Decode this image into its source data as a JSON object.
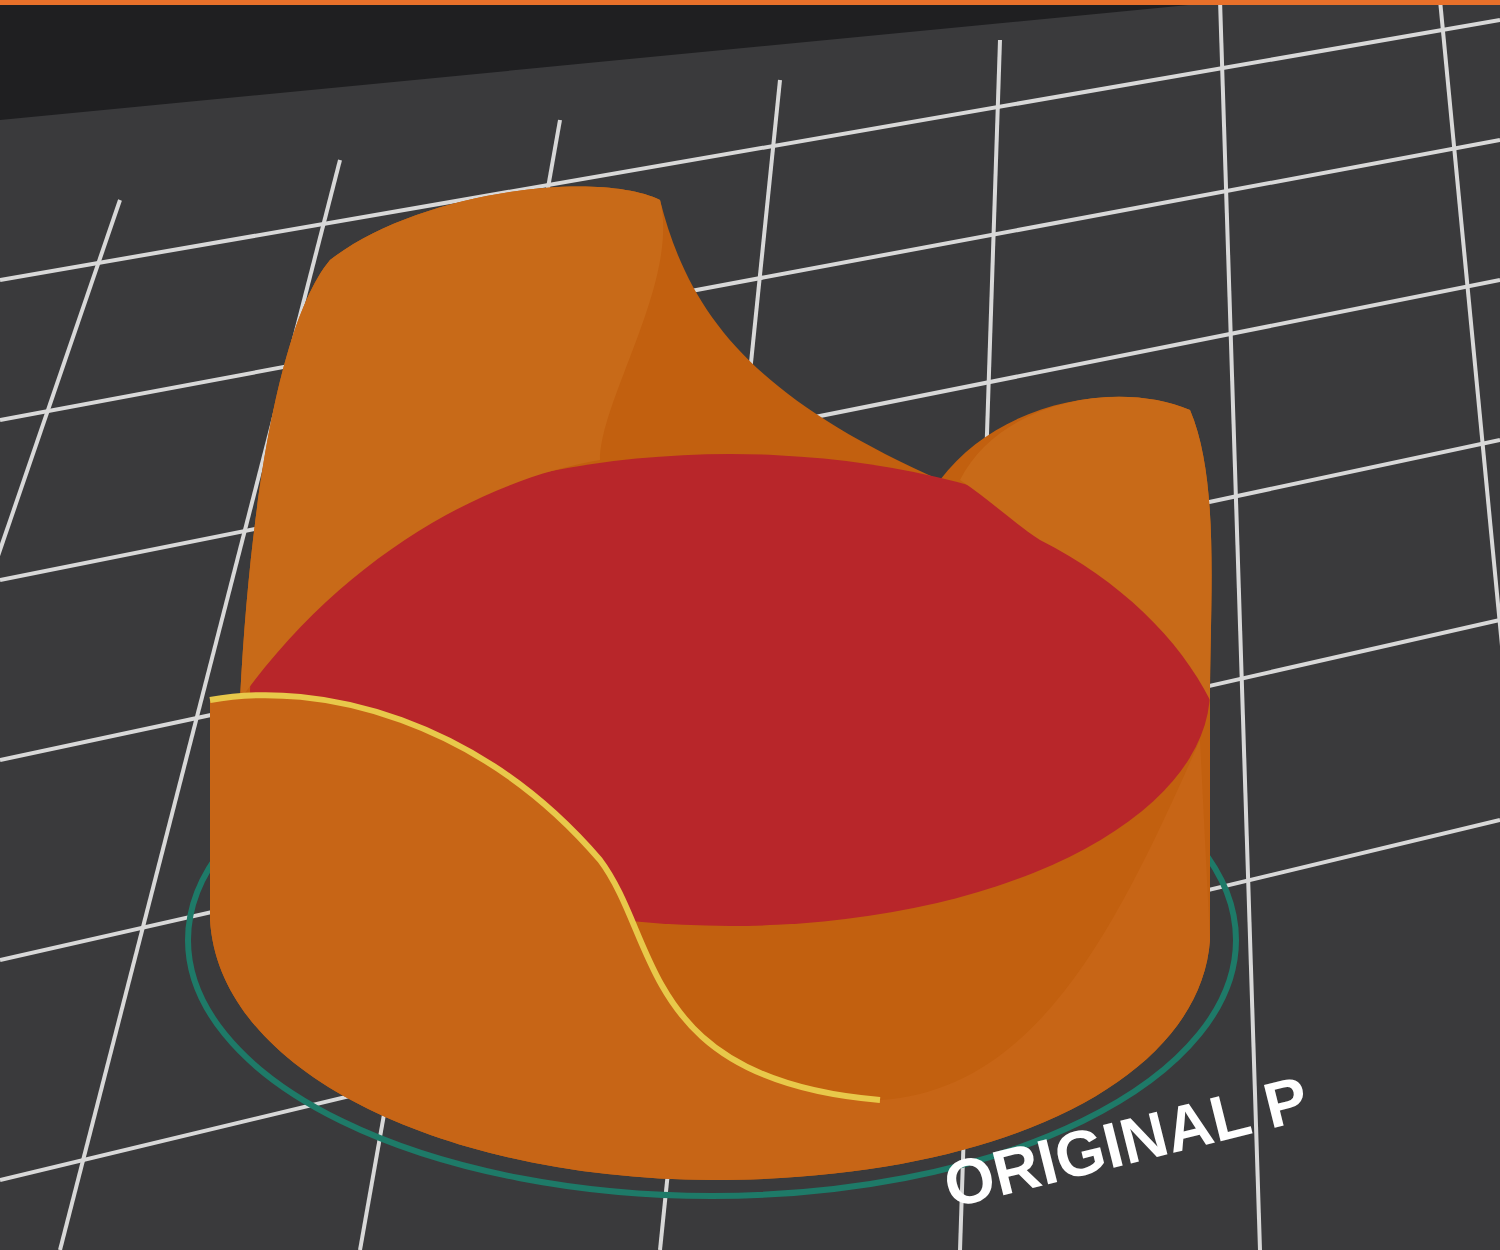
{
  "viewport": {
    "bed_label": "ORIGINAL P"
  }
}
